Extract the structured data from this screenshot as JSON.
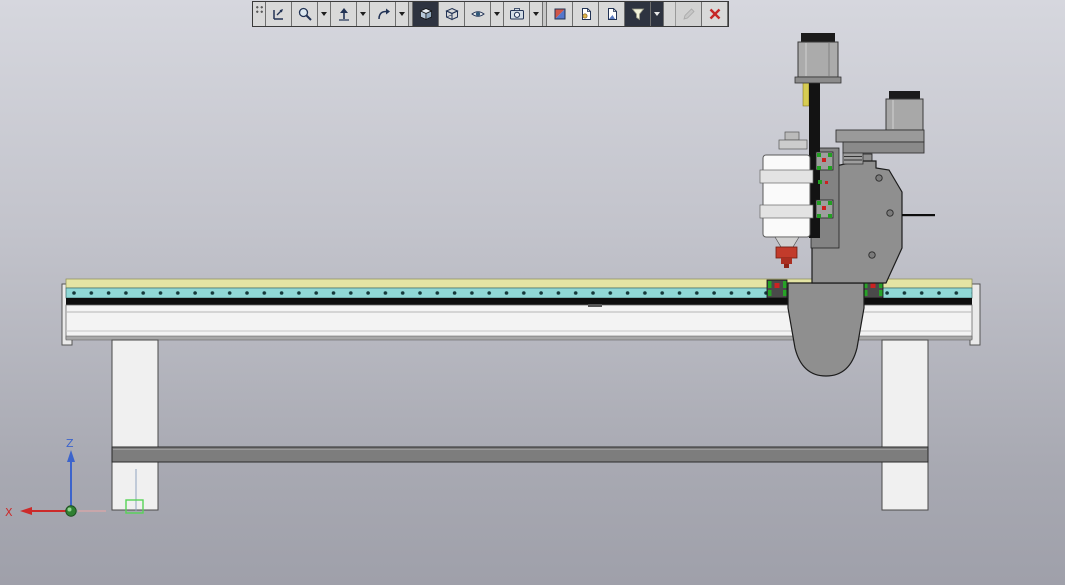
{
  "toolbar": {
    "buttons": [
      {
        "id": "grip",
        "name": "toolbar-grip-handle"
      },
      {
        "id": "view-orientation",
        "name": "view-orientation-button"
      },
      {
        "id": "zoom",
        "name": "zoom-button",
        "has_dropdown": true
      },
      {
        "id": "standard-view",
        "name": "standard-view-button",
        "has_dropdown": true
      },
      {
        "id": "rotate-view",
        "name": "rotate-view-button",
        "has_dropdown": true
      },
      {
        "id": "shaded",
        "name": "shaded-display-button",
        "pressed": true
      },
      {
        "id": "wireframe",
        "name": "wireframe-display-button"
      },
      {
        "id": "hide-show",
        "name": "hide-show-items-button",
        "has_dropdown": true
      },
      {
        "id": "apply-scene",
        "name": "apply-scene-button",
        "has_dropdown": true
      },
      {
        "id": "section-view",
        "name": "section-view-button"
      },
      {
        "id": "edit-appearance",
        "name": "edit-appearance-button"
      },
      {
        "id": "display-state",
        "name": "display-state-button"
      },
      {
        "id": "filter",
        "name": "selection-filter-button",
        "pressed": true,
        "has_dropdown": true
      },
      {
        "id": "edit",
        "name": "edit-button",
        "disabled": true
      },
      {
        "id": "close",
        "name": "close-toolbar-button"
      }
    ]
  },
  "triad": {
    "x_label": "X",
    "z_label": "Z"
  },
  "colors": {
    "viewport_top": "#d6d7de",
    "viewport_bottom": "#9fa0aa",
    "table_yellow": "#e4e4a4",
    "rail_cyan": "#90d8d6",
    "machine_gray": "#8f8f8f",
    "collet_red": "#c23b2b",
    "bearing_green": "#27a327",
    "axis_x_red": "#cc2a2a",
    "axis_z_blue": "#3c64cc",
    "selection_green": "#57d457"
  }
}
